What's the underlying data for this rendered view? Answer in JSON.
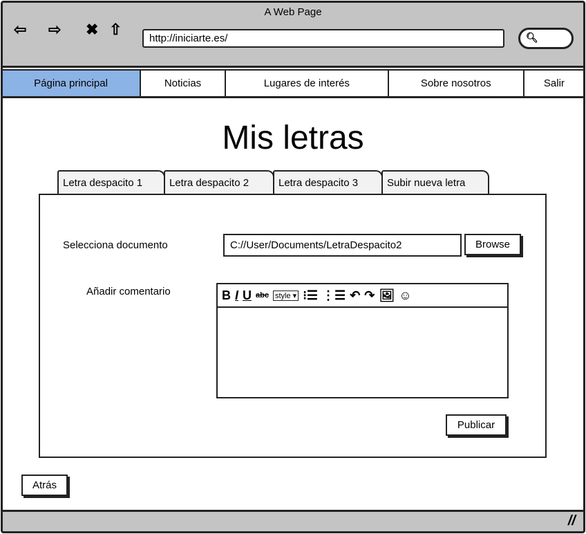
{
  "browser": {
    "title": "A Web Page",
    "url": "http://iniciarte.es/",
    "icons": [
      "back-arrow-icon",
      "forward-arrow-icon",
      "stop-icon",
      "home-icon",
      "search-icon"
    ]
  },
  "nav": {
    "items": [
      {
        "label": "Página principal",
        "active": true
      },
      {
        "label": "Noticias"
      },
      {
        "label": "Lugares de interés"
      },
      {
        "label": "Sobre nosotros"
      },
      {
        "label": "Salir"
      }
    ]
  },
  "page": {
    "title": "Mis letras"
  },
  "tabs": [
    "Letra despacito 1",
    "Letra despacito 2",
    "Letra despacito 3",
    "Subir nueva letra"
  ],
  "form": {
    "doc_label": "Selecciona documento",
    "doc_value": "C://User/Documents/LetraDespacito2",
    "browse": "Browse",
    "comment_label": "Añadir comentario",
    "style": "style",
    "publish": "Publicar"
  },
  "back": "Atrás",
  "colors": {
    "active_nav": "#8cb3e6",
    "chrome": "#c4c4c4"
  }
}
